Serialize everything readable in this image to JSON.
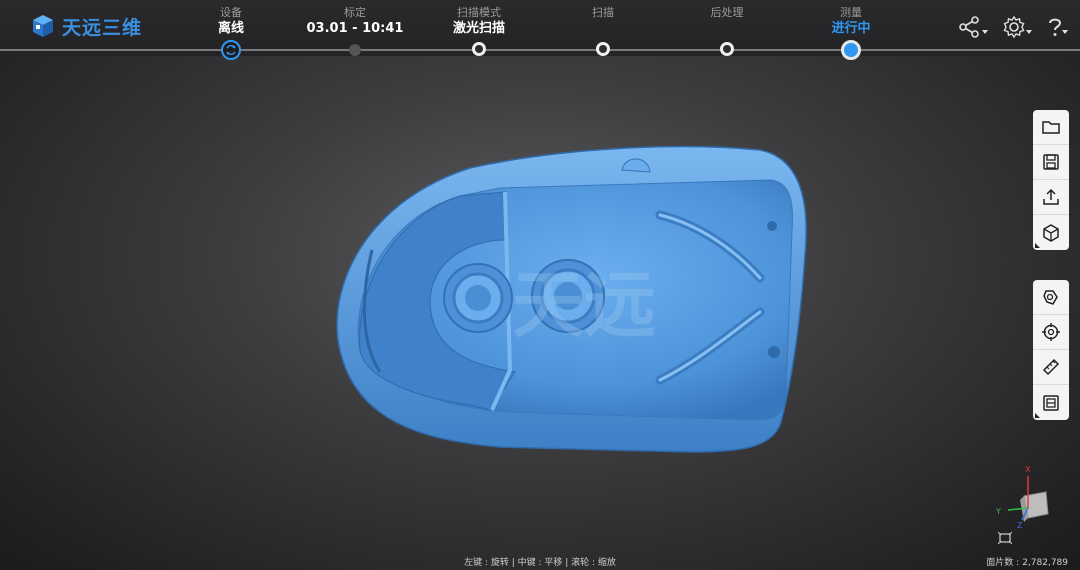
{
  "brand": {
    "name": "天远三维",
    "color": "#3a8fe0"
  },
  "workflow": {
    "steps": [
      {
        "label": "设备",
        "value": "离线",
        "state": "device"
      },
      {
        "label": "标定",
        "value": "03.01 - 10:41",
        "state": "done"
      },
      {
        "label": "扫描模式",
        "value": "激光扫描",
        "state": "open"
      },
      {
        "label": "扫描",
        "value": "",
        "state": "open"
      },
      {
        "label": "后处理",
        "value": "",
        "state": "open"
      },
      {
        "label": "测量",
        "value": "进行中",
        "state": "current"
      }
    ],
    "accent": "#2f97f2"
  },
  "header_icons": [
    "share-icon",
    "settings-icon",
    "help-icon"
  ],
  "toolbar_file": [
    "folder-open-icon",
    "save-icon",
    "export-icon",
    "model-view-icon"
  ],
  "toolbar_tools": [
    "select-tool-icon",
    "target-icon",
    "measure-tool-icon",
    "section-view-icon"
  ],
  "viewport": {
    "model_color": "#5b9fe0",
    "watermark": "天远",
    "mouse_hint": "左键 : 旋转 | 中键 : 平移 | 滚轮 : 缩放",
    "facet_label": "面片数 :",
    "facet_count": "2,782,789",
    "axes": {
      "x": "X",
      "y": "Y",
      "z": "Z"
    }
  }
}
